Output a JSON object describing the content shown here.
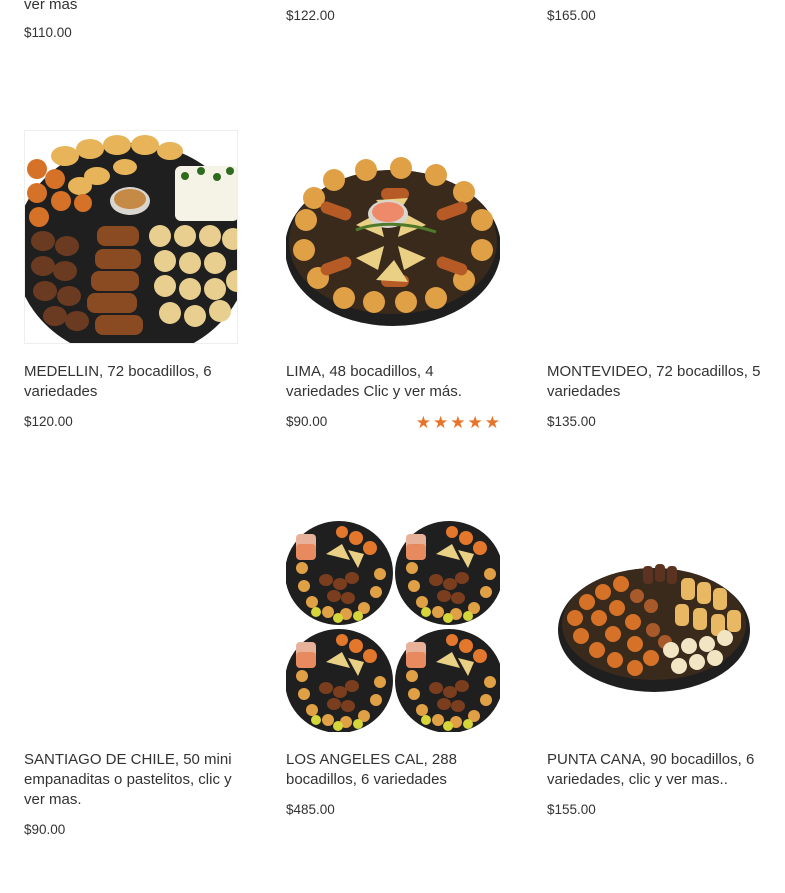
{
  "top_row": [
    {
      "title_tail": "ver mas",
      "price": "$110.00"
    },
    {
      "price": "$122.00"
    },
    {
      "price": "$165.00"
    }
  ],
  "products": [
    {
      "title": "MEDELLIN, 72 bocadillos, 6 variedades",
      "price": "$120.00",
      "image": "party-platter-medellin"
    },
    {
      "title": "LIMA, 48 bocadillos, 4 variedades Clic y ver más.",
      "price": "$90.00",
      "image": "party-platter-lima",
      "rating_stars": 5
    },
    {
      "title": "MONTEVIDEO, 72 bocadillos, 5 variedades",
      "price": "$135.00",
      "image": ""
    },
    {
      "title": "SANTIAGO DE CHILE, 50 mini empanaditas o pastelitos, clic y ver mas.",
      "price": "$90.00",
      "image": ""
    },
    {
      "title": "LOS ANGELES CAL, 288 bocadillos, 6 variedades",
      "price": "$485.00",
      "image": "four-party-platters"
    },
    {
      "title": "PUNTA CANA, 90 bocadillos, 6 variedades, clic y ver mas..",
      "price": "$155.00",
      "image": "party-platter-punta-cana"
    }
  ],
  "colors": {
    "star": "#e8742b",
    "text": "#333333",
    "tray": "#1f1f1f"
  }
}
